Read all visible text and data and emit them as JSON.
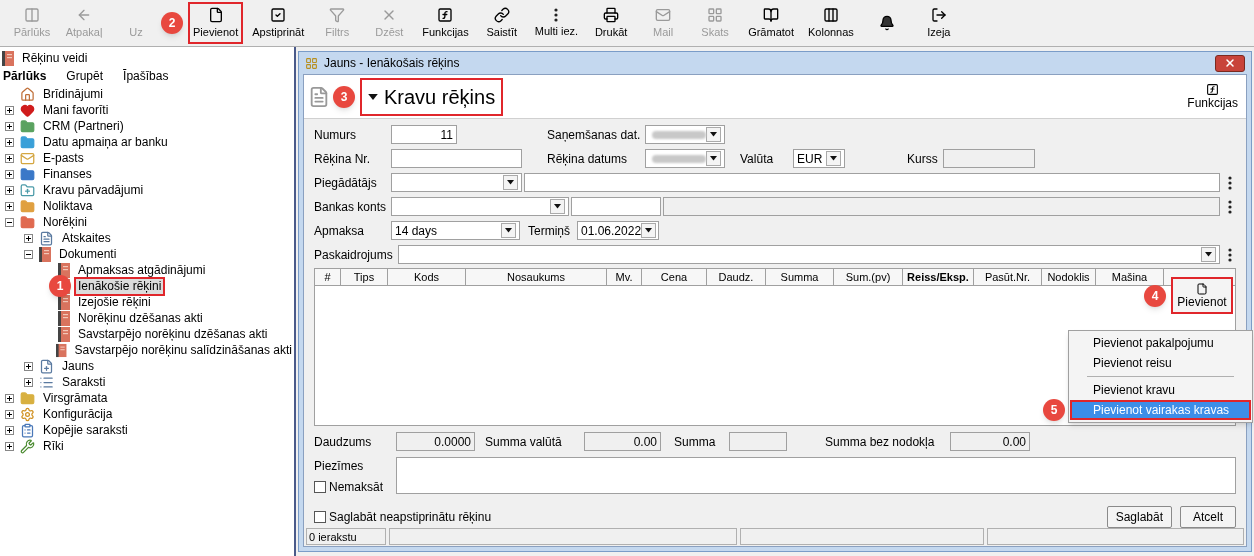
{
  "toolbar": {
    "buttons": [
      {
        "label": "Pārlūks",
        "disabled": true,
        "highlighted": false
      },
      {
        "label": "Atpakaļ",
        "disabled": true,
        "highlighted": false
      },
      {
        "label": "Uz",
        "disabled": true,
        "highlighted": false
      },
      {
        "label": "Pievienot",
        "disabled": false,
        "highlighted": true,
        "callout": "2"
      },
      {
        "label": "Apstiprināt",
        "disabled": false,
        "highlighted": false
      },
      {
        "label": "Filtrs",
        "disabled": true,
        "highlighted": false
      },
      {
        "label": "Dzēst",
        "disabled": true,
        "highlighted": false
      },
      {
        "label": "Funkcijas",
        "disabled": false,
        "highlighted": false
      },
      {
        "label": "Saistīt",
        "disabled": false,
        "highlighted": false
      },
      {
        "label": "Multi iez.",
        "disabled": false,
        "highlighted": false
      },
      {
        "label": "Drukāt",
        "disabled": false,
        "highlighted": false
      },
      {
        "label": "Mail",
        "disabled": true,
        "highlighted": false
      },
      {
        "label": "Skats",
        "disabled": true,
        "highlighted": false
      },
      {
        "label": "Grāmatot",
        "disabled": false,
        "highlighted": false
      },
      {
        "label": "Kolonnas",
        "disabled": false,
        "highlighted": false
      },
      {
        "disabled": false,
        "highlighted": false
      },
      {
        "label": "Izeja",
        "disabled": false,
        "highlighted": false
      }
    ]
  },
  "sidebar": {
    "title": "Rēķinu veidi",
    "tabs": [
      {
        "label": "Pārlūks",
        "selected": true
      },
      {
        "label": "Grupēt",
        "selected": false
      },
      {
        "label": "Īpašības",
        "selected": false
      }
    ],
    "tree": [
      {
        "label": "Brīdinājumi",
        "selected": false
      },
      {
        "label": "Mani favorīti",
        "expanded": false,
        "selected": false
      },
      {
        "label": "CRM (Partneri)",
        "expanded": false,
        "selected": false
      },
      {
        "label": "Datu apmaiņa ar banku",
        "expanded": false,
        "selected": false
      },
      {
        "label": "E-pasts",
        "expanded": false,
        "selected": false
      },
      {
        "label": "Finanses",
        "expanded": false,
        "selected": false
      },
      {
        "label": "Kravu pārvadājumi",
        "expanded": false,
        "selected": false
      },
      {
        "label": "Noliktava",
        "expanded": false,
        "selected": false
      },
      {
        "label": "Norēķini",
        "expanded": true,
        "selected": false,
        "children": [
          {
            "label": "Atskaites",
            "expanded": false,
            "selected": false
          },
          {
            "label": "Dokumenti",
            "expanded": true,
            "selected": false,
            "children": [
              {
                "label": "Apmaksas atgādinājumi",
                "selected": false
              },
              {
                "label": "Ienākošie rēķini",
                "selected": true,
                "callout": "1"
              },
              {
                "label": "Izejošie rēķini",
                "selected": false
              },
              {
                "label": "Norēķinu dzēšanas akti",
                "selected": false
              },
              {
                "label": "Savstarpējo norēķinu dzēšanas akti",
                "selected": false
              },
              {
                "label": "Savstarpējo norēķinu salīdzināšanas akti",
                "selected": false
              }
            ]
          },
          {
            "label": "Jauns",
            "expanded": false,
            "selected": false
          },
          {
            "label": "Saraksti",
            "expanded": false,
            "selected": false
          }
        ]
      },
      {
        "label": "Virsgrāmata",
        "expanded": false,
        "selected": false
      },
      {
        "label": "Konfigurācija",
        "expanded": false,
        "selected": false
      },
      {
        "label": "Kopējie saraksti",
        "expanded": false,
        "selected": false
      },
      {
        "label": "Rīki",
        "expanded": false,
        "selected": false
      }
    ]
  },
  "dialog": {
    "title": "Jauns - Ienākošais rēķins",
    "heading": "Kravu rēķins",
    "heading_callout": "3",
    "functions_label": "Funkcijas",
    "form": {
      "numurs": {
        "label": "Numurs",
        "value": "11"
      },
      "sanemsanas": {
        "label": "Saņemšanas dat."
      },
      "rekina_nr": {
        "label": "Rēķina Nr."
      },
      "rekina_datums": {
        "label": "Rēķina datums"
      },
      "valuta": {
        "label": "Valūta",
        "value": "EUR"
      },
      "kurss": {
        "label": "Kurss"
      },
      "piegadatajs": {
        "label": "Piegādātājs"
      },
      "bankas_konts": {
        "label": "Bankas konts"
      },
      "apmaksa": {
        "label": "Apmaksa",
        "value": "14 days"
      },
      "termins": {
        "label": "Termiņš",
        "value": "01.06.2022"
      },
      "paskaidrojums": {
        "label": "Paskaidrojums"
      }
    },
    "table": {
      "columns": [
        {
          "label": "#",
          "bold": false
        },
        {
          "label": "Tips",
          "bold": false
        },
        {
          "label": "Kods",
          "bold": false
        },
        {
          "label": "Nosaukums",
          "bold": false
        },
        {
          "label": "Mv.",
          "bold": false
        },
        {
          "label": "Cena",
          "bold": false
        },
        {
          "label": "Daudz.",
          "bold": false
        },
        {
          "label": "Summa",
          "bold": false
        },
        {
          "label": "Sum.(pv)",
          "bold": false
        },
        {
          "label": "Reiss/Eksp.",
          "bold": true
        },
        {
          "label": "Pasūt.Nr.",
          "bold": false
        },
        {
          "label": "Nodoklis",
          "bold": false
        },
        {
          "label": "Mašina",
          "bold": false
        }
      ]
    },
    "add_button": {
      "label": "Pievienot",
      "callout": "4"
    },
    "menu": [
      {
        "kind": "item",
        "label": "Pievienot pakalpojumu",
        "selected": false
      },
      {
        "kind": "item",
        "label": "Pievienot reisu",
        "selected": false
      },
      {
        "kind": "separator"
      },
      {
        "kind": "item",
        "label": "Pievienot kravu",
        "selected": false
      },
      {
        "kind": "item",
        "label": "Pievienot vairakas kravas",
        "selected": true,
        "callout": "5"
      }
    ],
    "totals": [
      {
        "label": "Daudzums",
        "value": "0.0000"
      },
      {
        "label": "Summa valūtā",
        "value": "0.00"
      },
      {
        "label": "Summa"
      },
      {
        "label": "Summa bez nodokļa",
        "value": "0.00"
      }
    ],
    "notes_label": "Piezīmes",
    "nemaksat": {
      "label": "Nemaksāt",
      "checked": false
    },
    "save_unapproved": {
      "label": "Saglabāt neapstiprinātu rēķinu",
      "checked": false
    },
    "buttons": [
      "Saglabāt",
      "Atcelt"
    ],
    "status_bar": [
      "0 ierakstu"
    ]
  }
}
